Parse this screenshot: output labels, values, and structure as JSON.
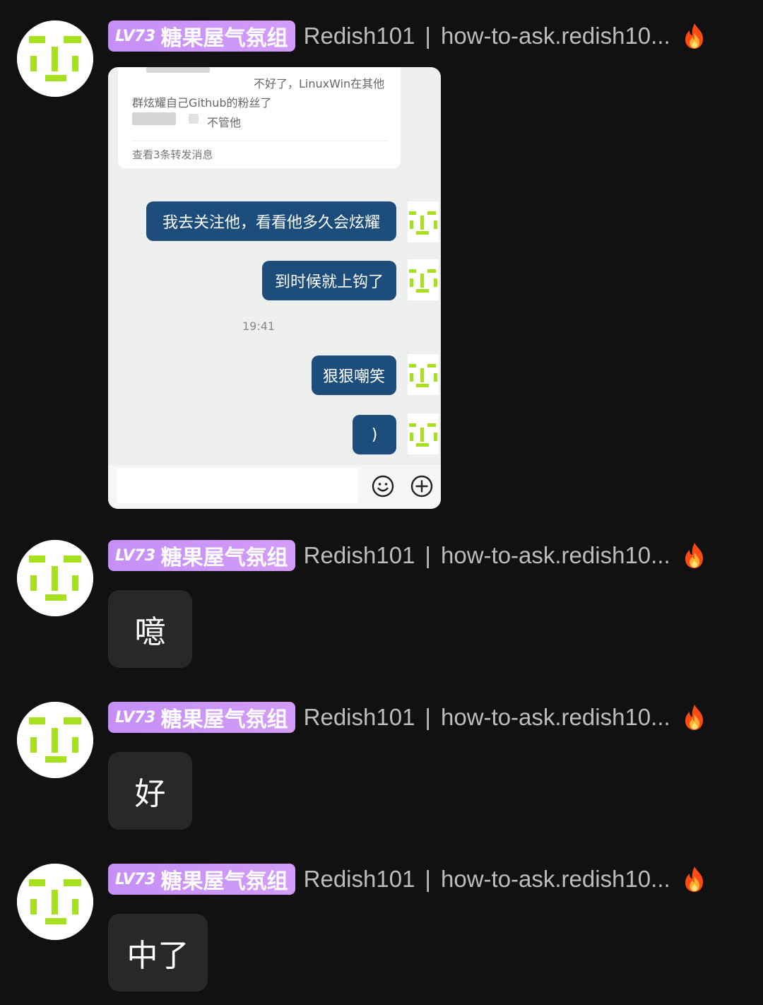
{
  "messages": [
    {
      "sender": {
        "level": "LV73",
        "group": "糖果屋气氛组",
        "name": "Redish101",
        "separator": "|",
        "site": "how-to-ask.redish10..."
      },
      "type": "image",
      "image": {
        "forward_line1": "不好了，LinuxWin在其他",
        "forward_line2": "群炫耀自己Github的粉丝了",
        "forward_line3": "不管他",
        "forward_more": "查看3条转发消息",
        "bubbles": [
          "我去关注他，看看他多久会炫耀",
          "到时候就上钩了",
          "狠狠嘲笑",
          ")"
        ],
        "timestamp": "19:41"
      }
    },
    {
      "sender": {
        "level": "LV73",
        "group": "糖果屋气氛组",
        "name": "Redish101",
        "separator": "|",
        "site": "how-to-ask.redish10..."
      },
      "type": "text",
      "text": "噫"
    },
    {
      "sender": {
        "level": "LV73",
        "group": "糖果屋气氛组",
        "name": "Redish101",
        "separator": "|",
        "site": "how-to-ask.redish10..."
      },
      "type": "text",
      "text": "好"
    },
    {
      "sender": {
        "level": "LV73",
        "group": "糖果屋气氛组",
        "name": "Redish101",
        "separator": "|",
        "site": "how-to-ask.redish10..."
      },
      "type": "text",
      "text": "中了"
    }
  ],
  "icons": {
    "avatar": "pixel-face-avatar",
    "flame": "flame-icon",
    "emoji": "smiley-icon",
    "plus": "plus-circle-icon"
  },
  "colors": {
    "background": "#111111",
    "badge": "#c58ff7",
    "bubble": "#282828",
    "avatar_green": "#a6e01e",
    "outgoing_bubble": "#1d4d7b"
  }
}
